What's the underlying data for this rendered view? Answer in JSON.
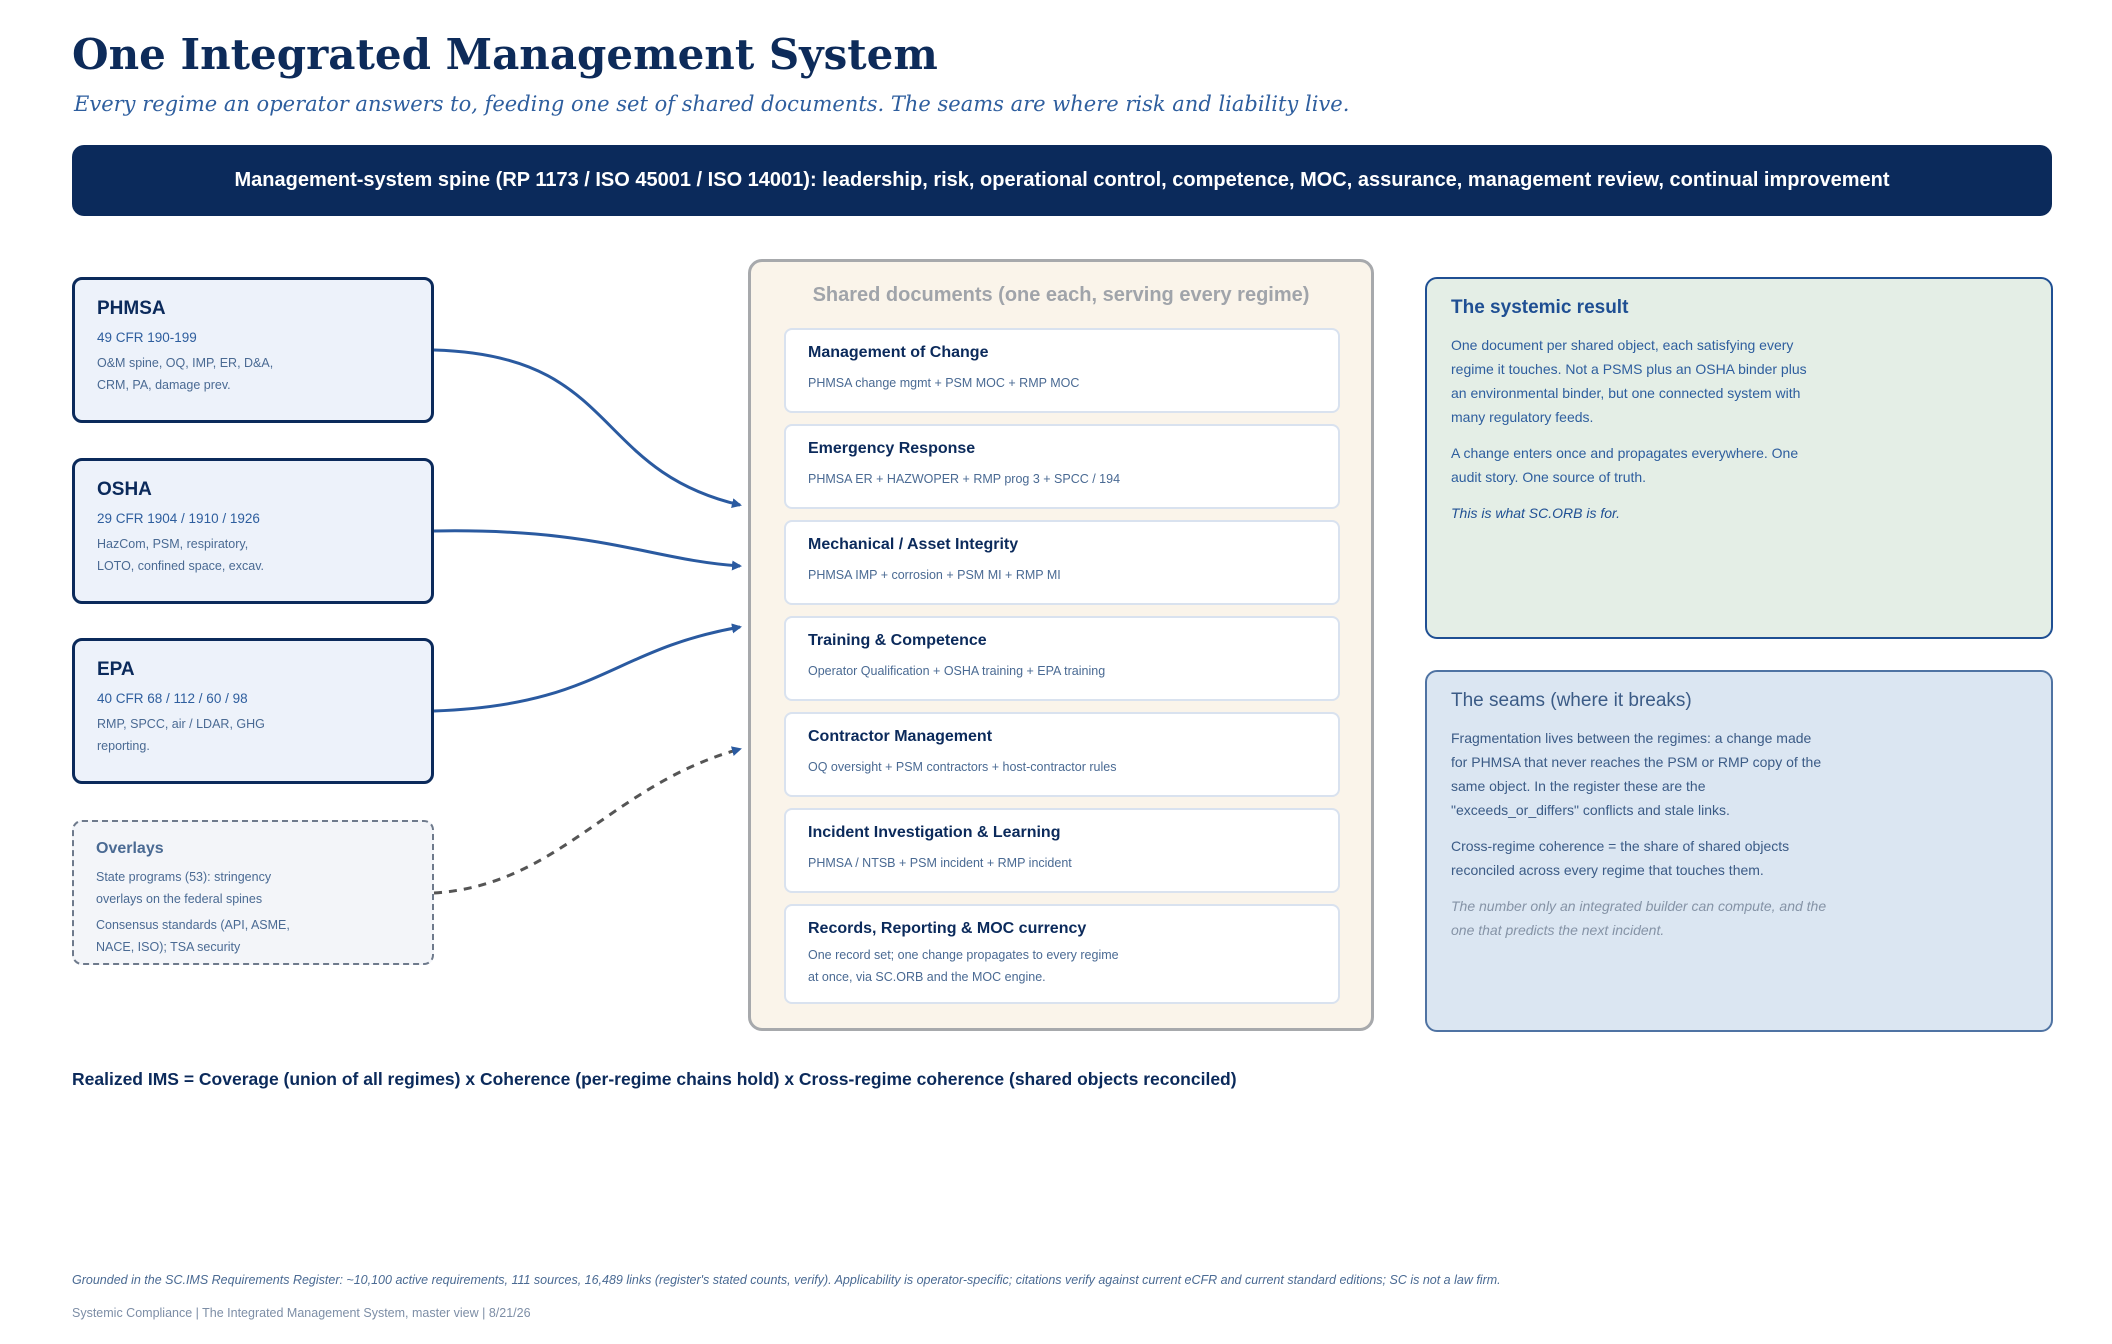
{
  "title": "One Integrated Management System",
  "subtitle": "Every regime an operator answers to, feeding one set of shared documents. The seams are where risk and liability live.",
  "spine": "Management-system spine (RP 1173 / ISO 45001 / ISO 14001): leadership, risk, operational control, competence, MOC, assurance, management review, continual improvement",
  "regimes": [
    {
      "name": "PHMSA",
      "cfr": "49 CFR 190-199",
      "desc": "O&M spine, OQ, IMP, ER, D&A, CRM, PA, damage prev."
    },
    {
      "name": "OSHA",
      "cfr": "29 CFR 1904 / 1910 / 1926",
      "desc": "HazCom, PSM, respiratory, LOTO, confined space, excav."
    },
    {
      "name": "EPA",
      "cfr": "40 CFR 68 / 112 / 60 / 98",
      "desc": "RMP, SPCC, air / LDAR, GHG reporting."
    }
  ],
  "overlays": {
    "name": "Overlays",
    "line1": "State programs (53): stringency overlays on the federal spines",
    "line2": "Consensus standards (API, ASME, NACE, ISO); TSA security"
  },
  "shared": {
    "title": "Shared documents (one each, serving every regime)",
    "docs": [
      {
        "title": "Management of Change",
        "sub": "PHMSA change mgmt + PSM MOC + RMP MOC"
      },
      {
        "title": "Emergency Response",
        "sub": "PHMSA ER + HAZWOPER + RMP prog 3 + SPCC / 194"
      },
      {
        "title": "Mechanical / Asset Integrity",
        "sub": "PHMSA IMP + corrosion + PSM MI + RMP MI"
      },
      {
        "title": "Training & Competence",
        "sub": "Operator Qualification + OSHA training + EPA training"
      },
      {
        "title": "Contractor Management",
        "sub": "OQ oversight + PSM contractors + host-contractor rules"
      },
      {
        "title": "Incident Investigation & Learning",
        "sub": "PHMSA / NTSB + PSM incident + RMP incident"
      },
      {
        "title": "Records, Reporting & MOC currency",
        "sub": "One record set; one change propagates to every regime at once, via SC.ORB and the MOC engine."
      }
    ]
  },
  "result": {
    "heading": "The systemic result",
    "p1": "One document per shared object, each satisfying every regime it touches. Not a PSMS plus an OSHA binder plus an environmental binder, but one connected system with many regulatory feeds.",
    "p2": "A change enters once and propagates everywhere. One audit story. One source of truth.",
    "p3": "This is what SC.ORB is for."
  },
  "seams": {
    "heading": "The seams (where it breaks)",
    "p1": "Fragmentation lives between the regimes: a change made for PHMSA that never reaches the PSM or RMP copy of the same object. In the register these are the \"exceeds_or_differs\" conflicts and stale links.",
    "p2": "Cross-regime coherence = the share of shared objects reconciled across every regime that touches them.",
    "p3": "The number only an integrated builder can compute, and the one that predicts the next incident."
  },
  "formula": "Realized IMS = Coverage (union of all regimes) x Coherence (per-regime chains hold) x Cross-regime coherence (shared objects reconciled)",
  "footnote": "Grounded in the SC.IMS Requirements Register: ~10,100 active requirements, 111 sources, 16,489 links (register's stated counts, verify). Applicability is operator-specific; citations verify against current eCFR and current standard editions; SC is not a law firm.",
  "footer": "Systemic Compliance | The Integrated Management System, master view | 8/21/26",
  "colors": {
    "navy": "#0b2a5b",
    "accent": "#2a5aa0",
    "dashed": "#555555",
    "shared_bg": "#faf4ea",
    "result_bg": "#e4eee6",
    "seams_bg": "#dbe6f2"
  }
}
